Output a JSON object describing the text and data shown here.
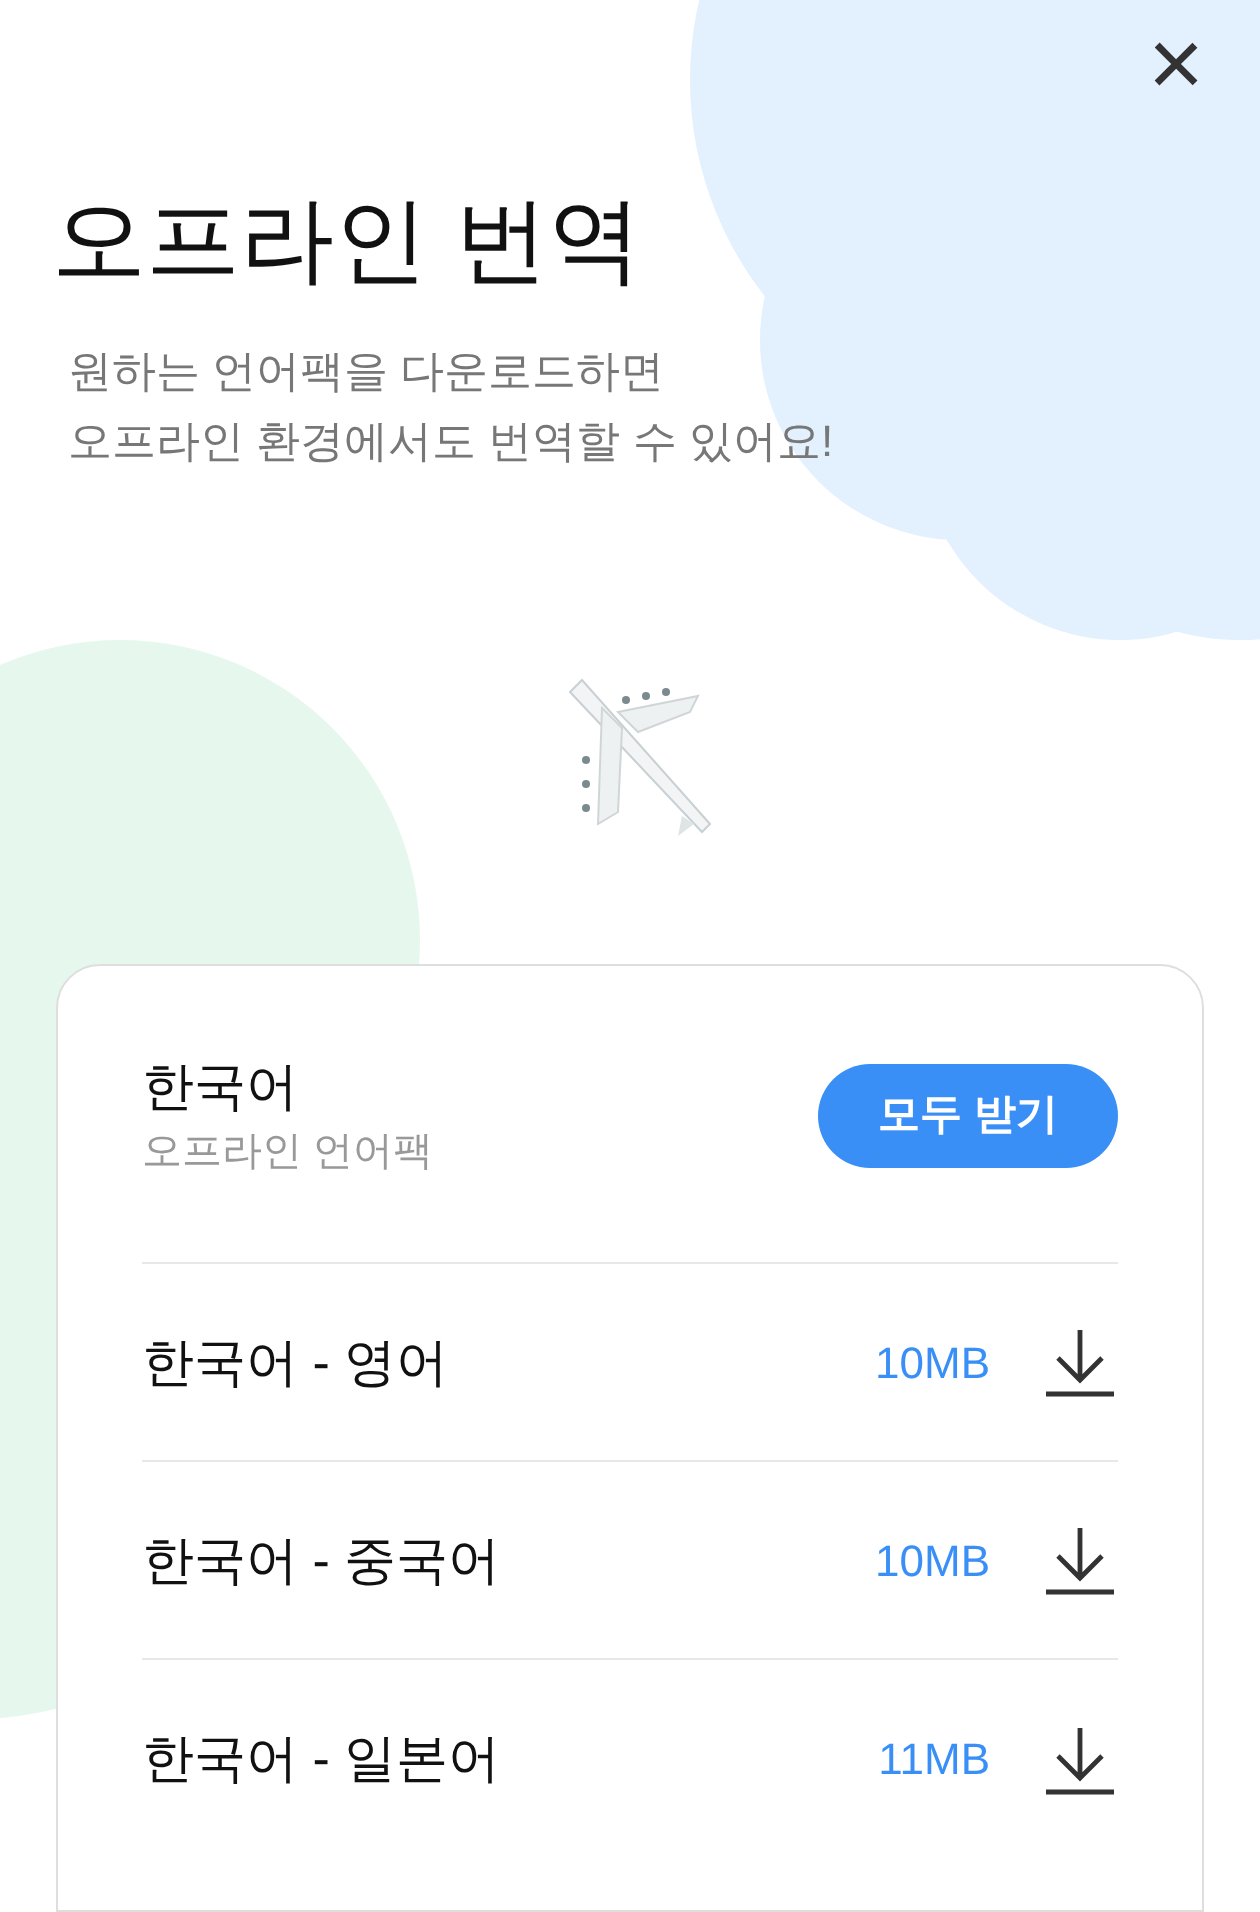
{
  "close_button": "×",
  "title": "오프라인 번역",
  "description": [
    "원하는 언어팩을 다운로드하면",
    "오프라인 환경에서도 번역할 수 있어요!"
  ],
  "card": {
    "title": "한국어",
    "subtitle": "오프라인 언어팩",
    "button": "모두 받기",
    "packs": [
      {
        "name": "한국어 - 영어",
        "size": "10MB"
      },
      {
        "name": "한국어 - 중국어",
        "size": "10MB"
      },
      {
        "name": "한국어 - 일본어",
        "size": "11MB"
      }
    ]
  }
}
